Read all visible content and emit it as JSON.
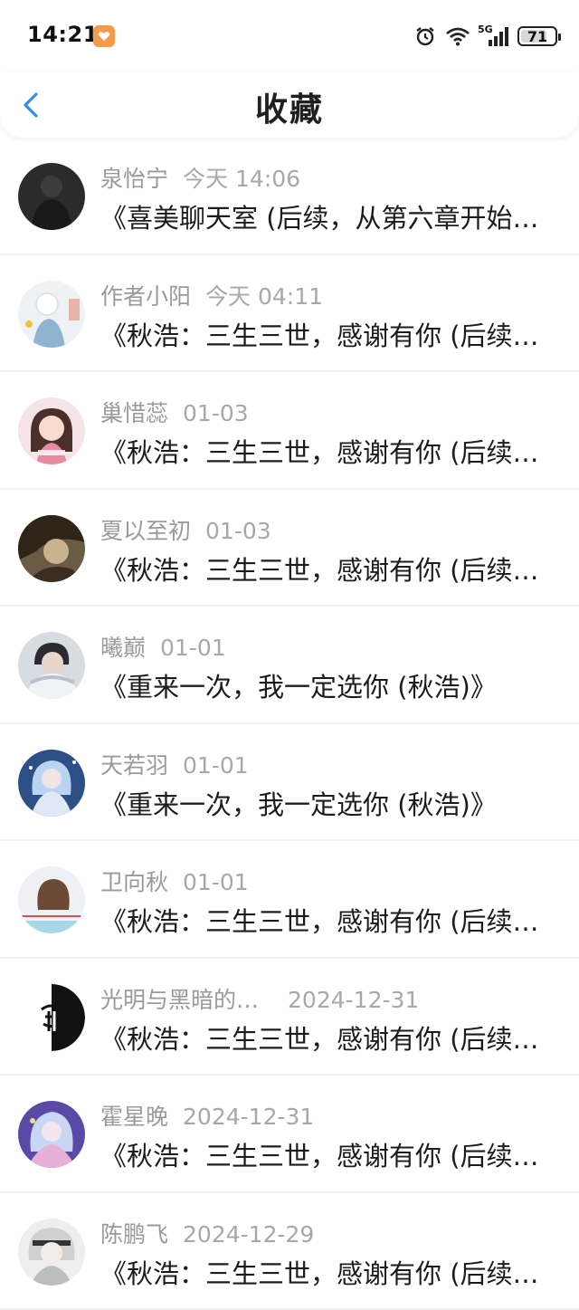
{
  "status_bar": {
    "time": "14:21",
    "network": "5G",
    "battery": "71"
  },
  "header": {
    "title": "收藏",
    "back_icon": "chevron-left-icon"
  },
  "colors": {
    "accent": "#2f8ff0",
    "badge": "#f59a48"
  },
  "favorites": [
    {
      "author": "泉怡宁",
      "time": "今天 14:06",
      "title": "《喜美聊天室 (后续，从第六章开始…"
    },
    {
      "author": "作者小阳",
      "time": "今天 04:11",
      "title": "《秋浩：三生三世，感谢有你 (后续…"
    },
    {
      "author": "巢惜蕊",
      "time": "01-03",
      "title": "《秋浩：三生三世，感谢有你 (后续…"
    },
    {
      "author": "夏以至初",
      "time": "01-03",
      "title": "《秋浩：三生三世，感谢有你 (后续…"
    },
    {
      "author": "曦巅",
      "time": "01-01",
      "title": "《重来一次，我一定选你 (秋浩)》"
    },
    {
      "author": "天若羽",
      "time": "01-01",
      "title": "《重来一次，我一定选你 (秋浩)》"
    },
    {
      "author": "卫向秋",
      "time": "01-01",
      "title": "《秋浩：三生三世，感谢有你 (后续…"
    },
    {
      "author": "光明与黑暗的…",
      "time": "2024-12-31",
      "title": "《秋浩：三生三世，感谢有你 (后续…"
    },
    {
      "author": "霍星晚",
      "time": "2024-12-31",
      "title": "《秋浩：三生三世，感谢有你 (后续…"
    },
    {
      "author": "陈鹏飞",
      "time": "2024-12-29",
      "title": "《秋浩：三生三世，感谢有你 (后续…"
    }
  ]
}
